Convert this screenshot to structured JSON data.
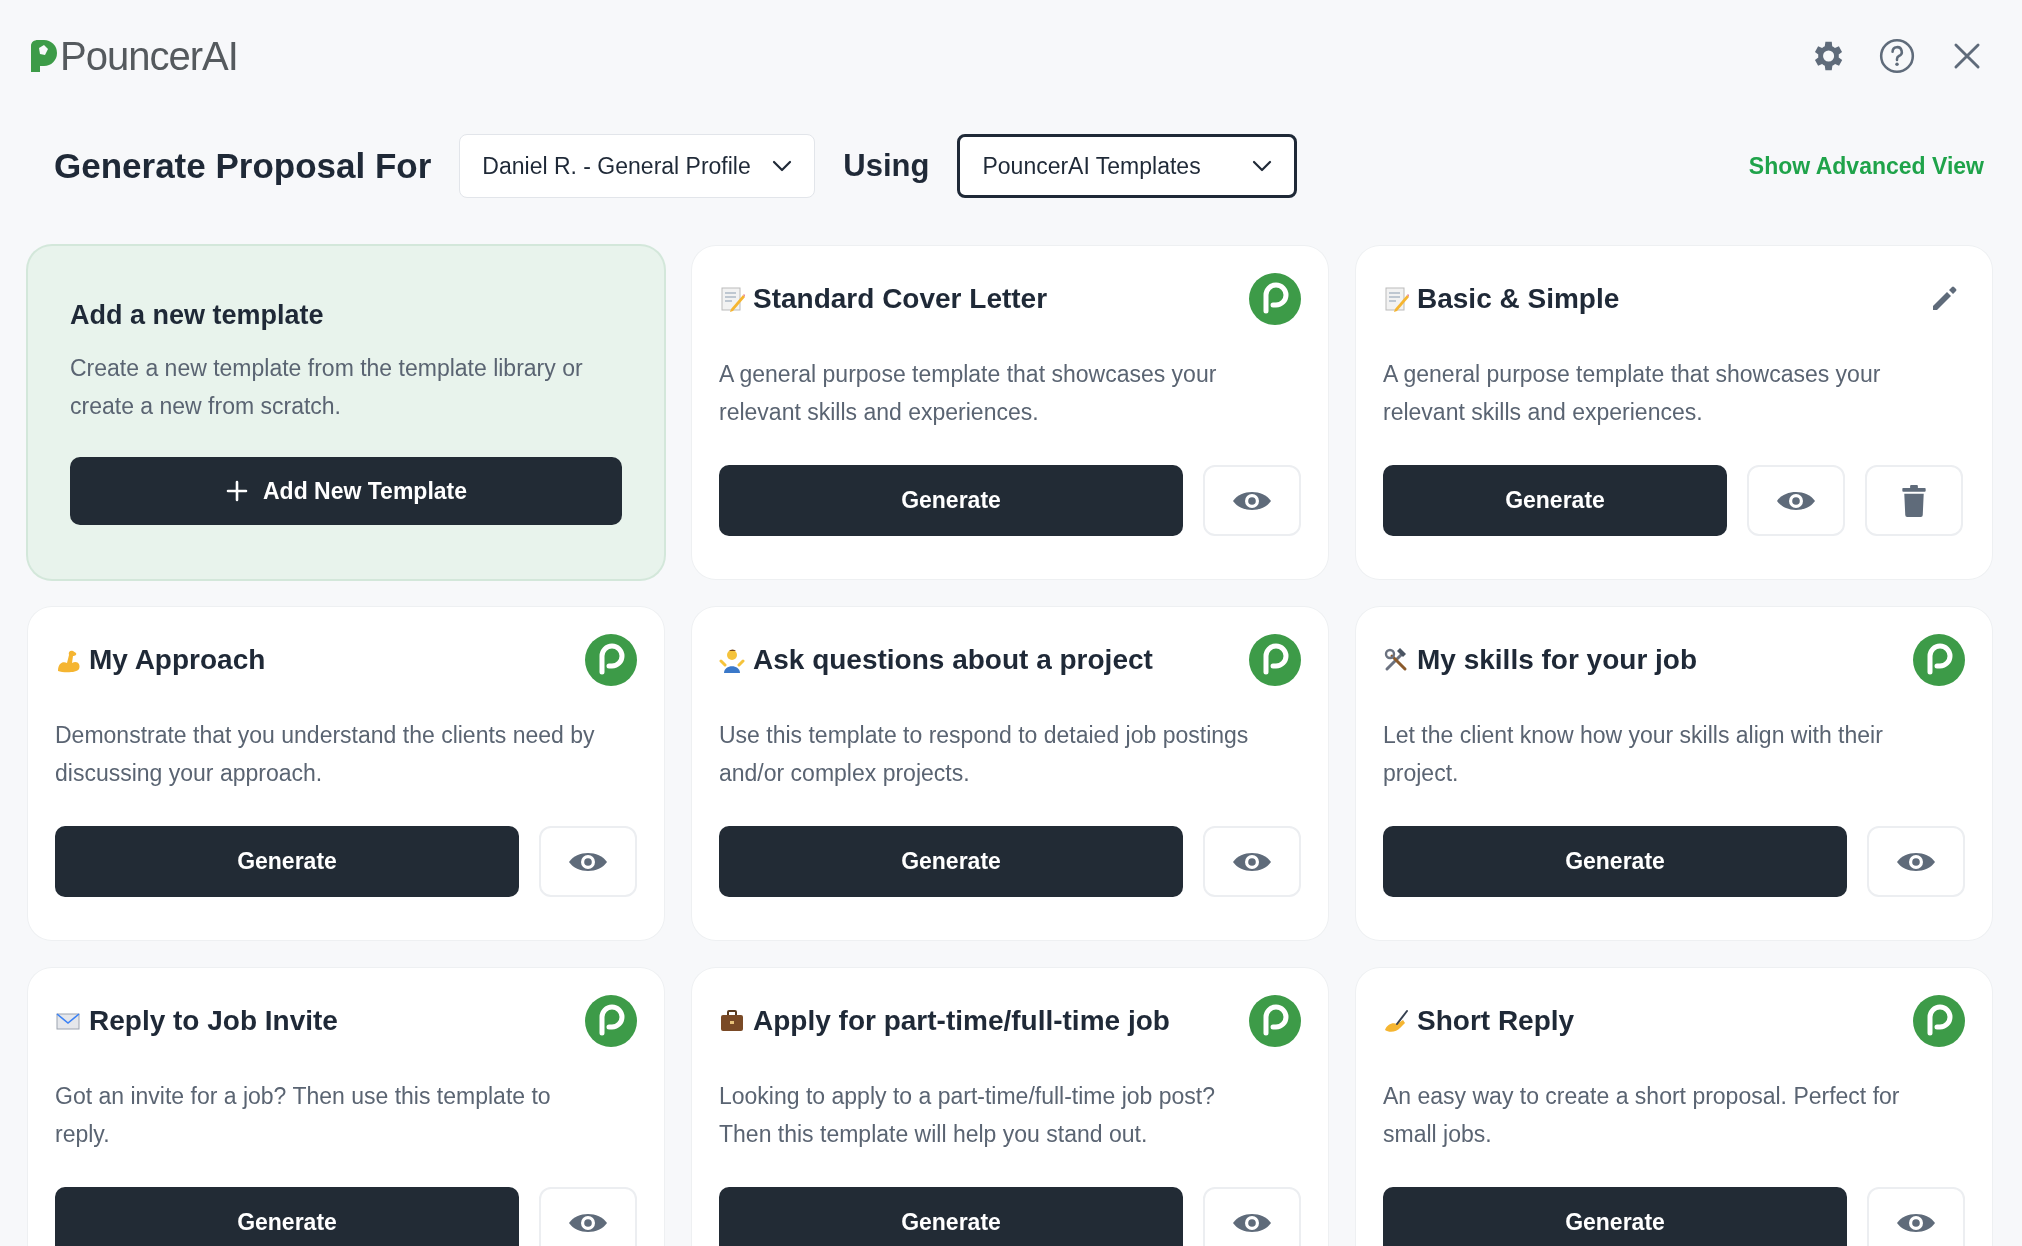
{
  "app": {
    "name": "PouncerAI"
  },
  "header": {
    "title": "Generate Proposal For",
    "profile_select": {
      "value": "Daniel R. - General Profile"
    },
    "using_label": "Using",
    "template_select": {
      "value": "PouncerAI Templates"
    },
    "advanced_link": "Show Advanced View"
  },
  "cards": [
    {
      "kind": "add",
      "title": "Add a new template",
      "description": "Create a new template from the template library or create a new from scratch.",
      "button": "Add New Template"
    },
    {
      "kind": "builtin",
      "title": "Standard Cover Letter",
      "description": "A general purpose template that showcases your relevant skills and experiences.",
      "button": "Generate"
    },
    {
      "kind": "custom",
      "title": "Basic & Simple",
      "description": "A general purpose template that showcases your relevant skills and experiences.",
      "button": "Generate"
    },
    {
      "kind": "builtin",
      "title": "My Approach",
      "description": "Demonstrate that you understand the clients need by discussing your approach.",
      "button": "Generate"
    },
    {
      "kind": "builtin",
      "title": "Ask questions about a project",
      "description": "Use this template to respond to detaied job postings and/or complex projects.",
      "button": "Generate"
    },
    {
      "kind": "builtin",
      "title": "My skills for your job",
      "description": "Let the client know how your skills align with their project.",
      "button": "Generate"
    },
    {
      "kind": "builtin",
      "title": "Reply to Job Invite",
      "description": "Got an invite for a job? Then use this template to reply.",
      "button": "Generate"
    },
    {
      "kind": "builtin",
      "title": "Apply for part-time/full-time job",
      "description": "Looking to apply to a part-time/full-time job post? Then this template will help you stand out.",
      "button": "Generate"
    },
    {
      "kind": "builtin",
      "title": "Short Reply",
      "description": "An easy way to create a short proposal. Perfect for small jobs.",
      "button": "Generate"
    }
  ]
}
